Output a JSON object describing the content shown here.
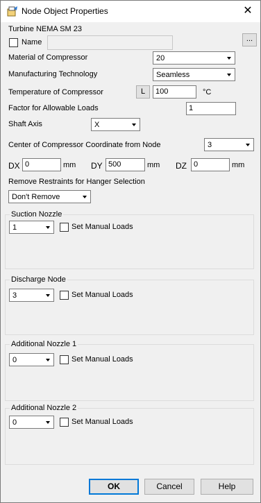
{
  "window": {
    "title": "Node Object Properties",
    "close_glyph": "✕",
    "icon": "node-properties-icon"
  },
  "header": {
    "section_title": "Turbine NEMA SM 23",
    "name_label": "Name",
    "name_value": "",
    "name_checked": false,
    "browse_label": "..."
  },
  "fields": {
    "material_label": "Material of Compressor",
    "material_value": "20",
    "manufacturing_label": "Manufacturing Technology",
    "manufacturing_value": "Seamless",
    "temperature_label": "Temperature of Compressor",
    "temperature_button": "L",
    "temperature_value": "100",
    "temperature_unit": "°C",
    "factor_label": "Factor for Allowable Loads",
    "factor_value": "1",
    "shaft_axis_label": "Shaft Axis",
    "shaft_axis_value": "X",
    "center_label": "Center of Compressor Coordinate from Node",
    "center_value": "3",
    "dx_label": "DX",
    "dx_value": "0",
    "dx_unit": "mm",
    "dy_label": "DY",
    "dy_value": "500",
    "dy_unit": "mm",
    "dz_label": "DZ",
    "dz_value": "0",
    "dz_unit": "mm",
    "remove_label": "Remove Restraints for Hanger Selection",
    "remove_value": "Don't Remove"
  },
  "groups": [
    {
      "title": "Suction Nozzle",
      "node_value": "1",
      "manual_label": "Set Manual Loads",
      "manual_checked": false
    },
    {
      "title": "Discharge Node",
      "node_value": "3",
      "manual_label": "Set Manual Loads",
      "manual_checked": false
    },
    {
      "title": "Additional Nozzle 1",
      "node_value": "0",
      "manual_label": "Set Manual Loads",
      "manual_checked": false
    },
    {
      "title": "Additional Nozzle 2",
      "node_value": "0",
      "manual_label": "Set Manual Loads",
      "manual_checked": false
    }
  ],
  "footer": {
    "ok_label": "OK",
    "cancel_label": "Cancel",
    "help_label": "Help"
  },
  "colors": {
    "accent": "#0078d7",
    "background": "#f0f0f0"
  }
}
